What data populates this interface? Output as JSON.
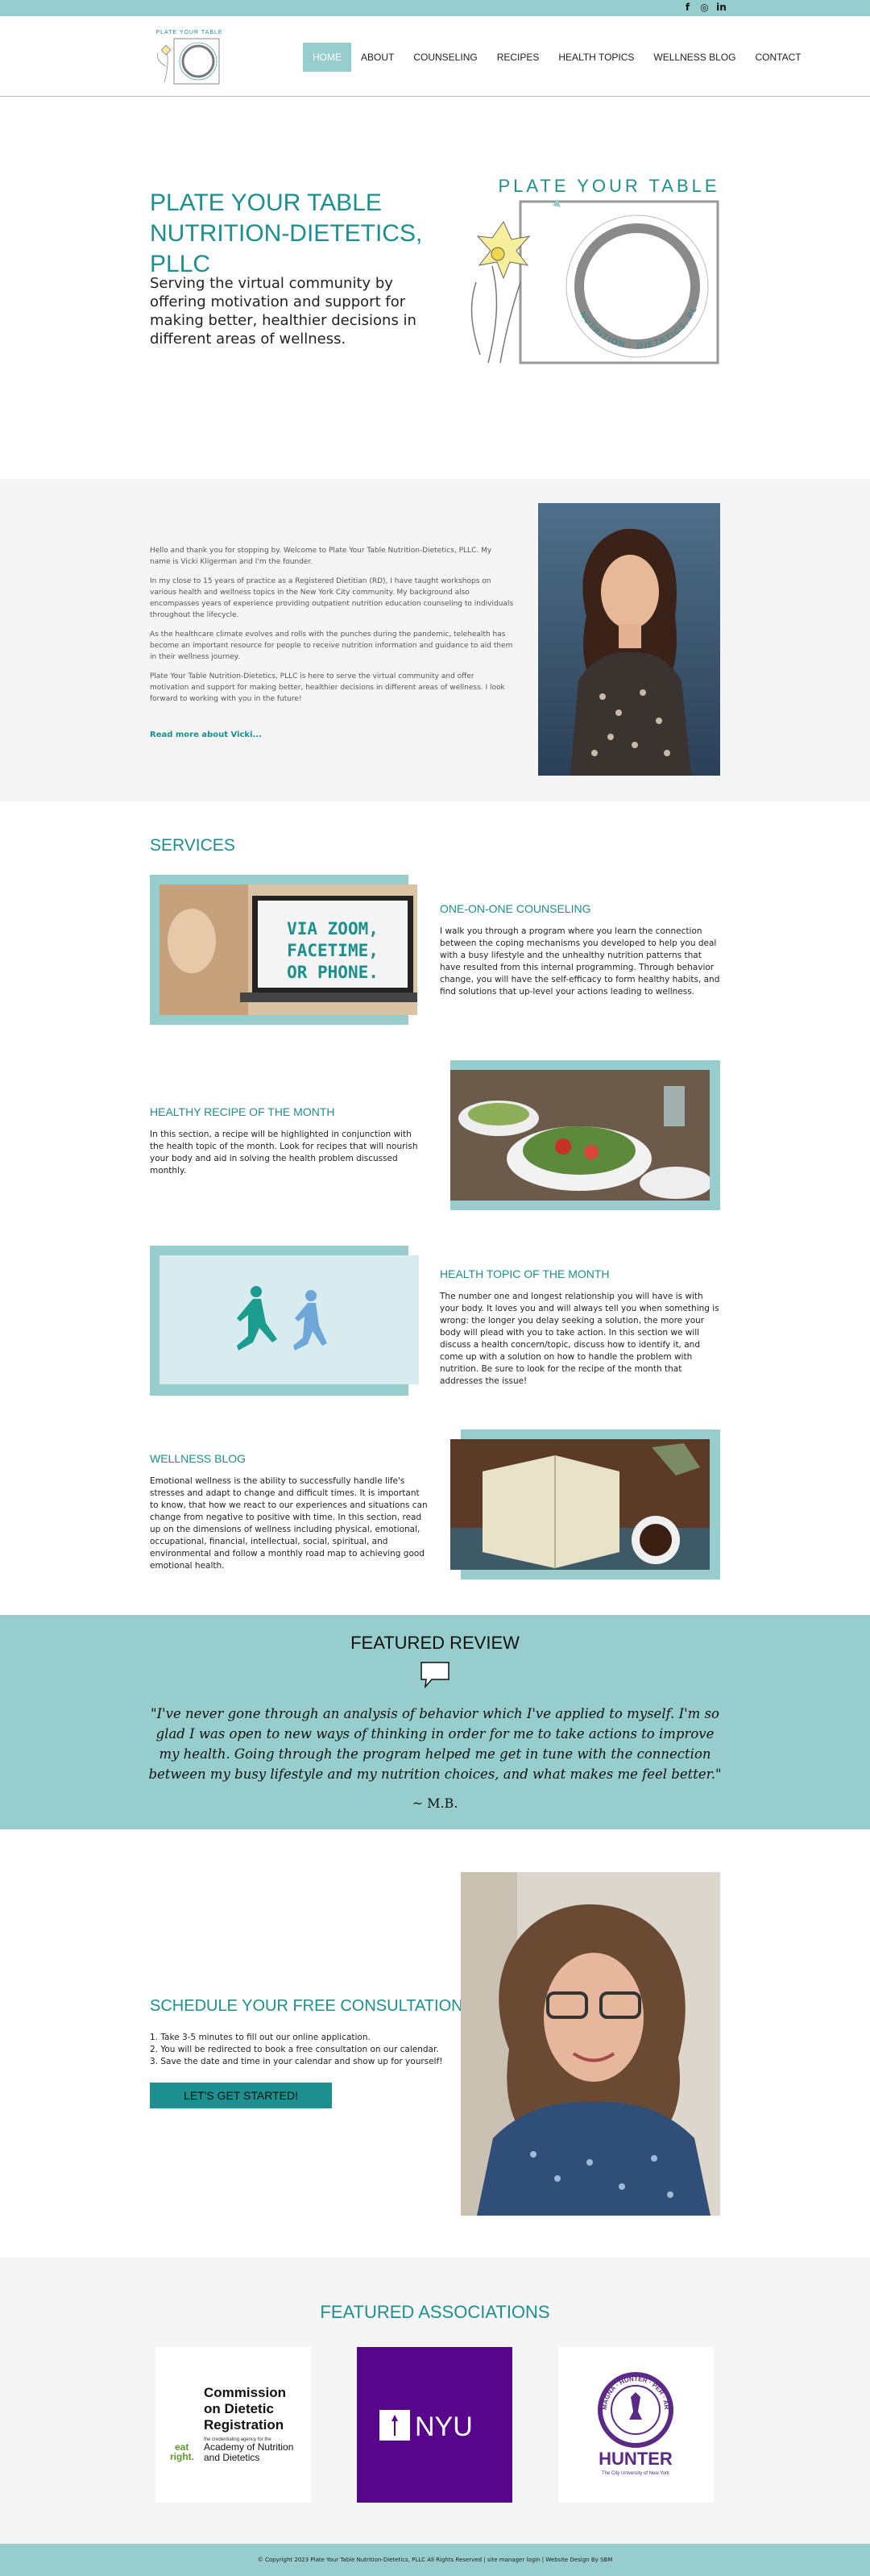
{
  "social": {
    "facebook": "f",
    "instagram": "◎",
    "linkedin": "in"
  },
  "nav": {
    "items": [
      "HOME",
      "ABOUT",
      "COUNSELING",
      "RECIPES",
      "HEALTH TOPICS",
      "WELLNESS BLOG",
      "CONTACT"
    ],
    "active": "HOME"
  },
  "logo": {
    "text": "PLATE YOUR TABLE",
    "ring_text": "NUTRITION - DIETETICS, PLLC"
  },
  "hero": {
    "title_line1": "PLATE YOUR TABLE",
    "title_line2": "NUTRITION-DIETETICS, PLLC",
    "subtitle": "Serving the virtual community by offering motivation and support for making better, healthier decisions in different areas of wellness."
  },
  "about": {
    "p1": "Hello and thank you for stopping by. Welcome to Plate Your Table Nutrition-Dietetics, PLLC. My name is Vicki Kligerman and I'm the founder.",
    "p2": "In my close to 15 years of practice as a Registered Dietitian (RD), I have taught workshops on various health and wellness topics in the New York City community. My background also encompasses years of experience providing outpatient nutrition education counseling to individuals throughout the lifecycle.",
    "p3": "As the healthcare climate evolves and rolls with the punches during the pandemic, telehealth has become an important resource for people to receive nutrition information and guidance to aid them in their wellness journey.",
    "p4": "Plate Your Table Nutrition-Dietetics, PLLC is here to serve the virtual community and offer motivation and support for making better, healthier decisions in different areas of wellness. I look forward to working with you in the future!",
    "link": "Read more about Vicki..."
  },
  "services": {
    "title": "SERVICES",
    "counseling": {
      "image_text_1": "VIA ZOOM,",
      "image_text_2": "FACETIME,",
      "image_text_3": "OR PHONE.",
      "heading": "ONE-ON-ONE COUNSELING",
      "body": "I walk you through a program where you learn the connection between the coping mechanisms you developed to help you deal with a busy lifestyle and the unhealthy nutrition patterns that have resulted from this internal programming. Through behavior change, you will have the self-efficacy to form healthy habits, and find solutions that up-level your actions leading to wellness."
    },
    "recipe": {
      "heading": "HEALTHY RECIPE OF THE MONTH",
      "body": "In this section, a recipe will be highlighted in conjunction with the health topic of the month. Look for recipes that will nourish your body and aid in solving the health problem discussed monthly."
    },
    "topic": {
      "heading": "HEALTH TOPIC OF THE MONTH",
      "body": "The number one and longest relationship you will have is with your body. It loves you and will always tell you when something is wrong: the longer you delay seeking a solution, the more your body will plead with you to take action. In this section we will discuss a health concern/topic, discuss how to identify it, and come up with a solution on how to handle the problem with nutrition. Be sure to look for the recipe of the month that addresses the issue!"
    },
    "blog": {
      "heading": "WELLNESS BLOG",
      "body": "Emotional wellness is the ability to successfully handle life's stresses and adapt to change and difficult times. It is important to know, that how we react to our experiences and situations can change from negative to positive with time. In this section, read up on the dimensions of wellness including physical, emotional, occupational, financial, intellectual, social, spiritual, and environmental and follow a monthly road map to achieving good emotional health."
    }
  },
  "review": {
    "title": "FEATURED REVIEW",
    "quote": "\"I've never gone through an analysis of behavior which I've applied to myself. I'm so glad I was open to new ways of thinking in order for me to take actions to improve my health. Going through the program helped me get in tune with the connection between my busy lifestyle and my nutrition choices, and what makes me feel better.\"",
    "author": "~ M.B."
  },
  "cta": {
    "title": "SCHEDULE YOUR FREE CONSULTATION TODAY!",
    "step1": "1. Take 3-5 minutes to fill out our online application.",
    "step2": "2. You will be redirected to book a free consultation on our calendar.",
    "step3": "3. Save the date and time in your calendar and show up for yourself!",
    "button": "LET'S GET STARTED!"
  },
  "associations": {
    "title": "FEATURED ASSOCIATIONS",
    "cdr_line1": "Commission",
    "cdr_line2": "on Dietetic",
    "cdr_line3": "Registration",
    "cdr_sub1": "the credentialing agency for the",
    "cdr_sub2": "Academy of Nutrition",
    "cdr_sub3": "and Dietetics",
    "cdr_mark1": "eat",
    "cdr_mark2": "right.",
    "nyu": "NYU",
    "hunter": "HUNTER",
    "hunter_sub": "The City University of New York",
    "hunter_ring": "MAGNA · HUNTER · PER · ARDUA · MDCCCLXX"
  },
  "footer": {
    "text": "© Copyright 2023 Plate Your Table Nutrition-Dietetics, PLLC All Rights Reserved | site manager login | Website Design By SBM"
  },
  "colors": {
    "accent": "#97cdcd",
    "brand": "#1c8f8e"
  }
}
